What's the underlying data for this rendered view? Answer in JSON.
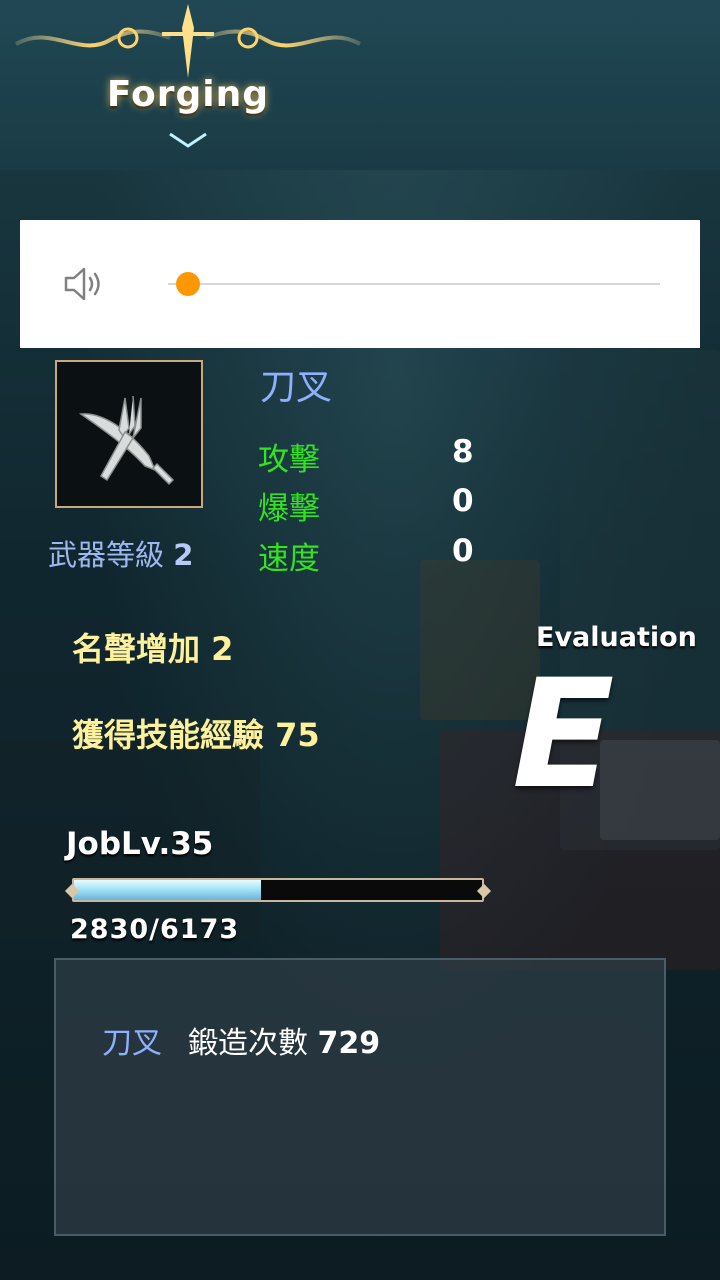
{
  "header": {
    "title": "Forging"
  },
  "volume": {
    "level": 0.0,
    "accent_color": "#ff9800"
  },
  "weapon": {
    "icon": "knife-fork-icon",
    "name": "刀叉",
    "level_label": "武器等級",
    "level_value": "2"
  },
  "stats": [
    {
      "label": "攻擊",
      "value": "8"
    },
    {
      "label": "爆擊",
      "value": "0"
    },
    {
      "label": "速度",
      "value": "0"
    }
  ],
  "rewards": {
    "fame_label": "名聲增加",
    "fame_value": "2",
    "skill_exp_label": "獲得技能經驗",
    "skill_exp_value": "75"
  },
  "evaluation": {
    "label": "Evaluation",
    "grade": "E"
  },
  "job": {
    "level_text": "JobLv.35",
    "exp_text": "2830/6173",
    "exp_current": 2830,
    "exp_max": 6173
  },
  "info": {
    "item_name": "刀叉",
    "count_label": "鍛造次數",
    "count_value": "729"
  },
  "colors": {
    "stat_label": "#32e41f",
    "weapon_name": "#8fb0ff",
    "reward_text": "#fff09a"
  }
}
